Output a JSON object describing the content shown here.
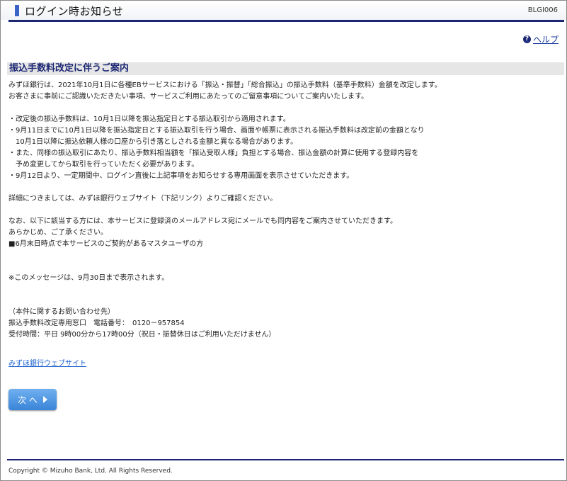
{
  "header": {
    "title": "ログイン時お知らせ",
    "screen_code": "BLGI006"
  },
  "help": {
    "icon": "help-circle-icon",
    "label": "ヘルプ"
  },
  "section": {
    "heading": "振込手数料改定に伴うご案内"
  },
  "body_lines": {
    "p1": "みずほ銀行は、2021年10月1日に各種EBサービスにおける「振込・振替」「総合振込」の振込手数料（基準手数料）金額を改定します。",
    "p2": "お客さまに事前にご認識いただきたい事項、サービスご利用にあたってのご留意事項についてご案内いたします。",
    "b1": "・改定後の振込手数料は、10月1日以降を振込指定日とする振込取引から適用されます。",
    "b2a": "・9月11日までに10月1日以降を振込指定日とする振込取引を行う場合、画面や帳票に表示される振込手数料は改定前の金額となり",
    "b2b": "　10月1日以降に振込依頼人様の口座から引き落としされる金額と異なる場合があります。",
    "b3a": "・また、同様の振込取引にあたり、振込手数料相当額を「振込受取人様」負担とする場合、振込金額の計算に使用する登録内容を",
    "b3b": "　予め変更してから取引を行っていただく必要があります。",
    "b4": "・9月12日より、一定期間中、ログイン直後に上記事項をお知らせする専用画面を表示させていただきます。",
    "detail": "詳細につきましては、みずほ銀行ウェブサイト（下記リンク）よりご確認ください。",
    "note1": "なお、以下に該当する方には、本サービスに登録済のメールアドレス宛にメールでも同内容をご案内させていただきます。",
    "note2": "あらかじめ、ご了承ください。",
    "note3": "■6月末日時点で本サービスのご契約があるマスタユーザの方",
    "display_until": "※このメッセージは、9月30日まで表示されます。",
    "contact_title": "（本件に関するお問い合わせ先）",
    "contact_desk": "振込手数料改定専用窓口　電話番号：　0120－957854",
    "contact_hours": "受付時間：平日 9時00分から17時00分（祝日・振替休日はご利用いただけません）"
  },
  "link": {
    "label": "みずほ銀行ウェブサイト"
  },
  "next_button": {
    "label": "次 へ",
    "icon": "triangle-right-icon"
  },
  "footer": {
    "copyright": "Copyright © Mizuho Bank, Ltd. All Rights Reserved."
  },
  "colors": {
    "accent_navy": "#1c2773",
    "header_marker": "#3b63c7",
    "button_blue": "#3a84d8",
    "link_blue": "#1a5fd0"
  }
}
